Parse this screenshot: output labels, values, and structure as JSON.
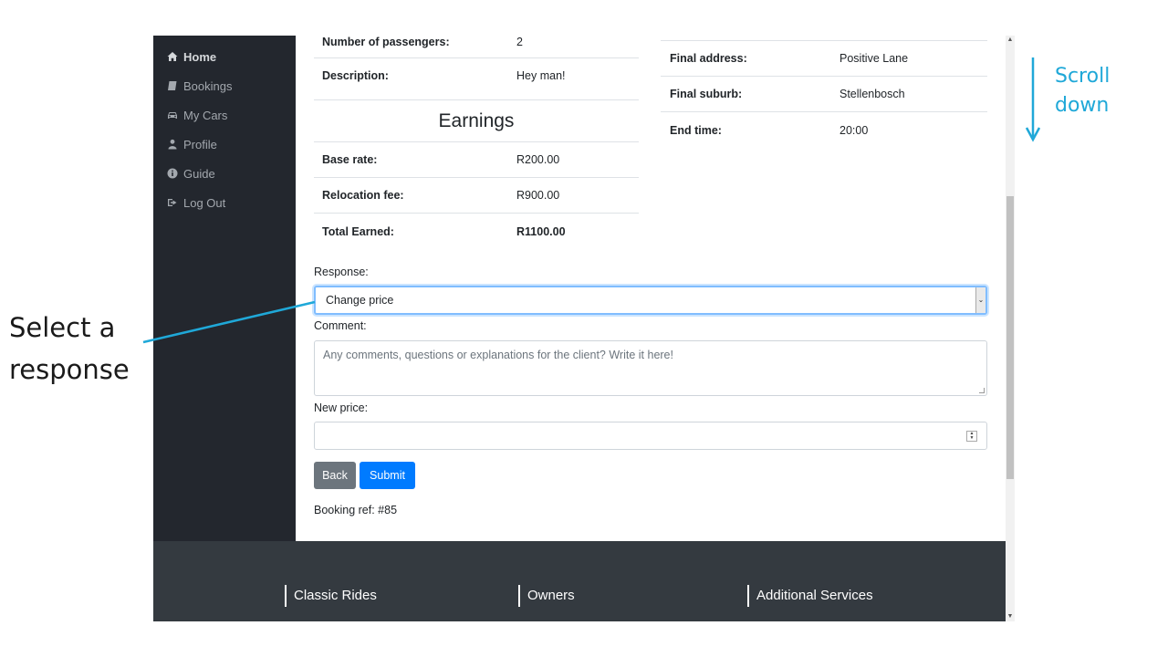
{
  "sidebar": {
    "items": [
      {
        "label": "Home",
        "icon": "home-icon",
        "active": true
      },
      {
        "label": "Bookings",
        "icon": "book-icon",
        "active": false
      },
      {
        "label": "My Cars",
        "icon": "car-icon",
        "active": false
      },
      {
        "label": "Profile",
        "icon": "user-icon",
        "active": false
      },
      {
        "label": "Guide",
        "icon": "info-icon",
        "active": false
      },
      {
        "label": "Log Out",
        "icon": "logout-icon",
        "active": false
      }
    ]
  },
  "details_left": {
    "passengers_label": "Number of passengers:",
    "passengers_value": "2",
    "description_label": "Description:",
    "description_value": "Hey man!"
  },
  "earnings": {
    "title": "Earnings",
    "base_rate_label": "Base rate:",
    "base_rate_value": "R200.00",
    "relocation_fee_label": "Relocation fee:",
    "relocation_fee_value": "R900.00",
    "total_label": "Total Earned:",
    "total_value": "R1100.00"
  },
  "details_right": {
    "final_address_label": "Final address:",
    "final_address_value": "Positive Lane",
    "final_suburb_label": "Final suburb:",
    "final_suburb_value": "Stellenbosch",
    "end_time_label": "End time:",
    "end_time_value": "20:00"
  },
  "form": {
    "response_label": "Response:",
    "response_selected": "Change price",
    "comment_label": "Comment:",
    "comment_placeholder": "Any comments, questions or explanations for the client? Write it here!",
    "new_price_label": "New price:",
    "new_price_value": "",
    "back_label": "Back",
    "submit_label": "Submit",
    "booking_ref": "Booking ref: #85"
  },
  "footer": {
    "columns": [
      "Classic Rides",
      "Owners",
      "Additional Services"
    ]
  },
  "annotations": {
    "select_line1": "Select a",
    "select_line2": "response",
    "scroll_line1": "Scroll",
    "scroll_line2": "down"
  },
  "colors": {
    "sidebar_bg": "#23272e",
    "footer_bg": "#343a40",
    "primary": "#007bff",
    "secondary": "#6c757d",
    "annotation_accent": "#1fa8d8"
  }
}
